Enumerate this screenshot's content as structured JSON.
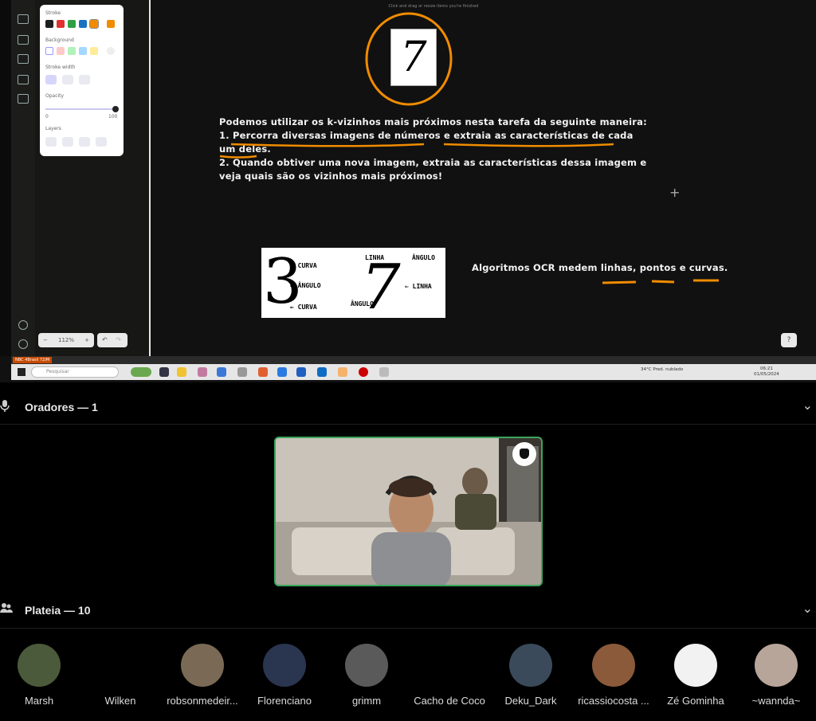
{
  "whiteboard": {
    "hint": "Click and drag or resize items you're finished",
    "props_panel": {
      "stroke_label": "Stroke",
      "background_label": "Background",
      "stroke_width_label": "Stroke width",
      "opacity_label": "Opacity",
      "opacity_min": "0",
      "opacity_max": "100",
      "layers_label": "Layers",
      "stroke_colors": [
        "#1e1e1e",
        "#e03131",
        "#2f9e44",
        "#1971c2",
        "#f08c00"
      ],
      "background_colors": [
        "#ffffff",
        "#ffc9c9",
        "#b2f2bb",
        "#a5d8ff",
        "#ffec99"
      ]
    },
    "zoom": "112%",
    "zoom_minus": "−",
    "zoom_plus": "+",
    "undo": "↶",
    "redo": "↷",
    "help": "?",
    "digit": "7",
    "paragraph": [
      "Podemos utilizar os k-vizinhos mais próximos nesta tarefa da seguinte maneira:",
      "1. Percorra diversas imagens de números e extraia as características de cada",
      "um deles.",
      "2. Quando obtiver uma nova imagem, extraia as características dessa imagem e",
      "veja quais são os vizinhos mais próximos!"
    ],
    "ocr_text": "Algoritmos OCR medem linhas, pontos e curvas.",
    "figure": {
      "digit_three": "3",
      "digit_seven": "7",
      "curva_top": "← CURVA",
      "angulo_left": "← ÂNGULO",
      "curva_bottom": "← CURVA",
      "linha_top": "LINHA",
      "angulo_top": "ÂNGULO",
      "linha_right": "⇐ LINHA",
      "angulo_bottom": "ÂNGULO"
    },
    "accent_color": "#f08c00"
  },
  "taskbar": {
    "search_placeholder": "Pesquisar",
    "status_tag": "NBC 4Brasil 72/M",
    "weather": "34°C Pred. nublado",
    "time": "06:21",
    "date": "01/05/2024"
  },
  "stage": {
    "speakers_title": "Oradores — 1",
    "audience_title": "Plateia — 10",
    "audience": [
      {
        "name": "Marsh",
        "color": "#4a5a3a"
      },
      {
        "name": "Wilken",
        "color": "#000000"
      },
      {
        "name": "robsonmedeir...",
        "color": "#7a6a55"
      },
      {
        "name": "Florenciano",
        "color": "#2a3550"
      },
      {
        "name": "grimm",
        "color": "#5a5a5a"
      },
      {
        "name": "Cacho de Coco",
        "color": "#000000"
      },
      {
        "name": "Deku_Dark",
        "color": "#3a4a5a"
      },
      {
        "name": "ricassiocosta ...",
        "color": "#8a5a3a"
      },
      {
        "name": "Zé Gominha",
        "color": "#f2f2f2"
      },
      {
        "name": "~wannda~",
        "color": "#b8a59a"
      }
    ]
  }
}
